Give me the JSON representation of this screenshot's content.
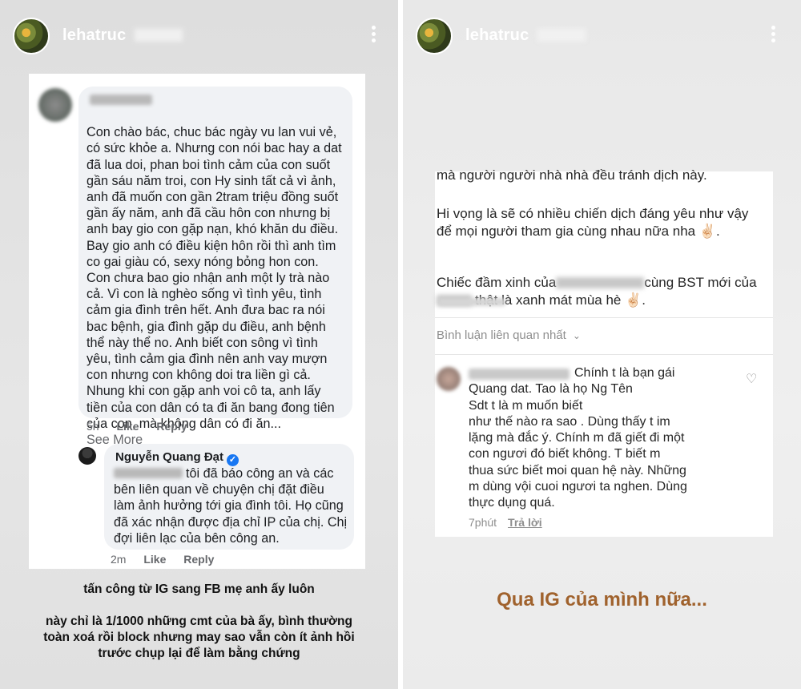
{
  "left_story": {
    "username": "lehatruc",
    "comment_1": {
      "text": "Con chào bác, chuc bác ngày vu lan vui vẻ,\ncó sức khỏe a. Nhưng con nói bac hay a dat\nđã lua doi, phan boi tình cảm của con suốt\ngần sáu năm troi, con Hy sinh tất cả vì ảnh,\nanh đã muốn con gần 2tram triệu đồng suốt\ngần ấy năm, anh đã cầu hôn con nhưng bị\nanh bay gio con gặp nạn, khó khăn du điều.\nBay gio anh có điều kiện hôn rồi thì anh tìm\nco gai giàu có, sexy nóng bỏng hon con.\nCon chưa bao gio nhận anh một ly trà nào\ncả. Vì con là nghèo sống vì tình yêu, tình\ncảm gia đình trên hết. Anh đưa bac ra nói\nbac bệnh, gia đình gặp du điều, anh bệnh\nthể này thể no. Anh biết con sông vì tình\nyêu, tình  cảm gia đình nên anh vay mượn\ncon nhưng con không doi tra liền gì cả.\nNhung khi con gặp anh  voi cô ta, anh lấy\ntiền của con dân có ta đi ăn  bang đong tiên\ncủa con, mà không dân có đi ăn...",
      "see_more": "See More",
      "time": "5h",
      "like": "Like",
      "reply": "Reply"
    },
    "reply_1": {
      "name": "Nguyễn Quang Đạt",
      "verified_glyph": "✓",
      "text": "tôi đã báo công an và các\nbên liên quan về chuyện chị đặt điều\nlàm ảnh hưởng tới gia đình tôi. Họ cũng\nđã xác nhận được địa chỉ IP của chị. Chị\nđợi liên lạc của bên công an.",
      "time": "2m",
      "like": "Like",
      "reply": "Reply"
    },
    "caption_1": "tấn công từ IG sang FB mẹ anh ấy luôn",
    "caption_2": "này chỉ là 1/1000 những cmt của bà ấy, bình thường\ntoàn xoá rồi block nhưng may sao vẫn còn ít ảnh hồi\ntrước chụp lại để làm bằng chứng"
  },
  "right_story": {
    "username": "lehatruc",
    "post_line_1": "mà người người nhà nhà đều tránh dịch này.",
    "post_para_2": "Hi vọng là sẽ có nhiều chiến dịch đáng yêu như vậy\nđể mọi người tham gia cùng nhau nữa nha ✌🏻.",
    "post_para_3_a": "Chiếc đầm xinh của",
    "post_para_3_b": "cùng BST mới của",
    "post_para_3_c": "thật là xanh mát mùa hè ✌🏻.",
    "related_label": "Bình luận liên quan nhất",
    "related_chevron": "⌄",
    "comment": {
      "text": "Chính t    là bạn gái\nQuang dat. Tao là họ Ng        Tên\nSdt t     là                   m     muốn biết\nnhư thế nào ra sao . Dùng thấy t     im\nlặng mà đắc ý. Chính m     đã giết đi một\ncon ngươi đó biết không. T     biết m\nthua sức biết moi quan hệ này. Những\nm      dùng vội cuoi ngươi ta nghen. Dùng\nthực dụng quá.",
      "time": "7phút",
      "reply": "Trả lời"
    },
    "heart_glyph": "♡",
    "big_caption": "Qua IG của mình nữa..."
  }
}
